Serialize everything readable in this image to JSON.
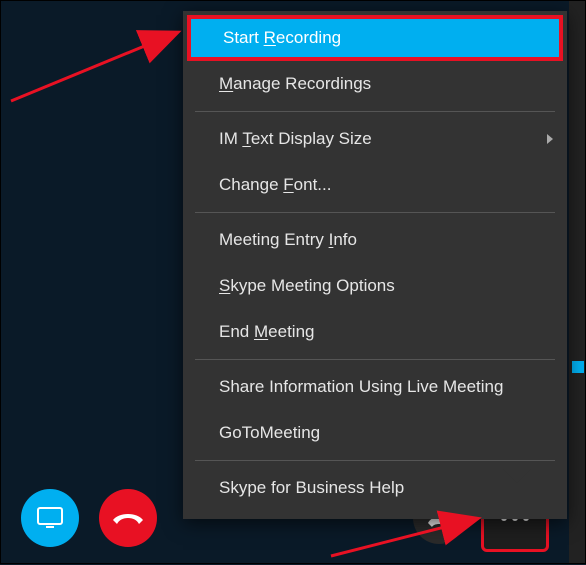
{
  "menu": {
    "items": [
      {
        "label": "Start Recording",
        "accel": "R",
        "highlight": true
      },
      {
        "label": "Manage Recordings",
        "accel": "M"
      },
      {
        "label": "IM Text Display Size",
        "accel": "T",
        "submenu": true
      },
      {
        "label": "Change Font...",
        "accel": "F"
      },
      {
        "label": "Meeting Entry Info",
        "accel": "I"
      },
      {
        "label": "Skype Meeting Options",
        "accel": "S"
      },
      {
        "label": "End Meeting",
        "accel": "M2"
      },
      {
        "label": "Share Information Using Live Meeting"
      },
      {
        "label": "GoToMeeting"
      },
      {
        "label": "Skype for Business Help"
      }
    ]
  },
  "toolbar": {
    "share": "Present",
    "hangup": "Hang Up",
    "dial": "Call Controls",
    "more": "More Options"
  },
  "colors": {
    "accent": "#00aff0",
    "danger": "#e81123",
    "menu_bg": "#333333",
    "bg": "#0a1a28"
  }
}
